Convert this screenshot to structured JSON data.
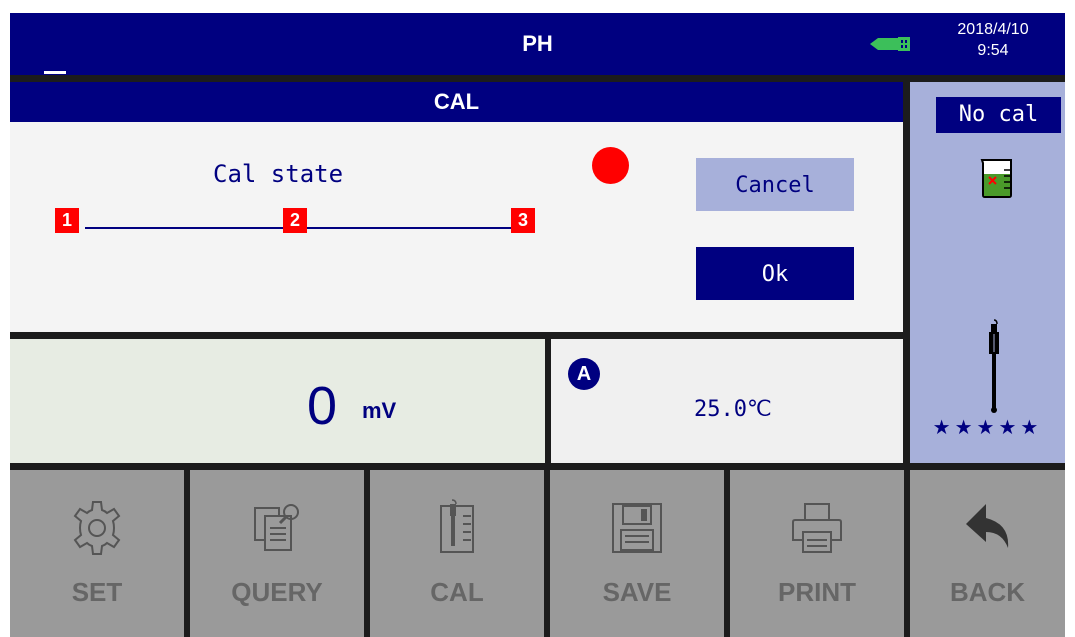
{
  "header": {
    "title": "PH",
    "date": "2018/4/10",
    "time": "9:54",
    "indicator_icon": "usb-icon"
  },
  "cal_panel": {
    "title": "CAL",
    "state_label": "Cal state",
    "points": [
      "1",
      "2",
      "3"
    ],
    "status_indicator_color": "#ff0000",
    "cancel_label": "Cancel",
    "ok_label": "Ok"
  },
  "reading": {
    "value": "0",
    "unit": "mV"
  },
  "temperature": {
    "channel_badge": "A",
    "value": "25.0℃"
  },
  "side_panel": {
    "cal_status": "No cal",
    "beaker_icon": "beaker-icon",
    "probe_icon": "electrode-icon",
    "rating": "★★★★★"
  },
  "toolbar": [
    {
      "label": "SET",
      "icon": "gear-icon"
    },
    {
      "label": "QUERY",
      "icon": "query-icon"
    },
    {
      "label": "CAL",
      "icon": "calibration-icon"
    },
    {
      "label": "SAVE",
      "icon": "floppy-icon"
    },
    {
      "label": "PRINT",
      "icon": "printer-icon"
    },
    {
      "label": "BACK",
      "icon": "back-arrow-icon"
    }
  ],
  "colors": {
    "primary": "#000080",
    "accent_light": "#a7b0da",
    "alert": "#ff0000",
    "toolbar_bg": "#9a9a9a"
  }
}
